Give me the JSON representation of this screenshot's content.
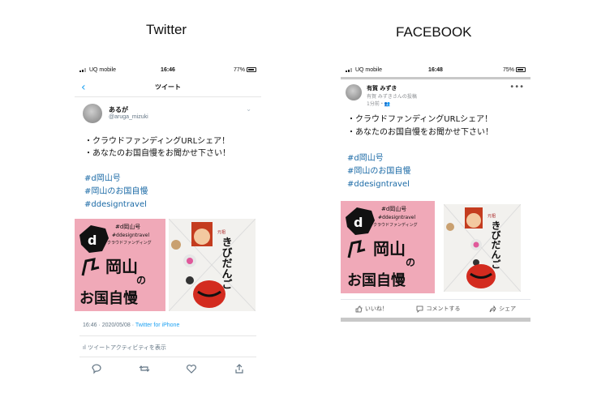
{
  "columns": {
    "twitter_title": "Twitter",
    "facebook_title": "FACEBOOK"
  },
  "twitter": {
    "status": {
      "carrier": "UQ mobile",
      "time": "16:46",
      "battery": "77%"
    },
    "nav_title": "ツイート",
    "user": {
      "name": "あるが",
      "handle": "@aruga_mizuki"
    },
    "body_lines": [
      "・クラウドファンディングURLシェア！",
      "・あなたのお国自慢をお聞かせ下さい！"
    ],
    "hashtags": [
      "#d岡山号",
      "#岡山のお国自慢",
      "#ddesigntravel"
    ],
    "timestamp": "16:46 · 2020/05/08 · ",
    "source": "Twitter for iPhone",
    "activity_label": "ツイートアクティビティを表示",
    "icons": [
      "reply-icon",
      "retweet-icon",
      "like-icon",
      "share-icon"
    ]
  },
  "facebook": {
    "status": {
      "carrier": "UQ mobile",
      "time": "16:48",
      "battery": "75%"
    },
    "user": {
      "name": "有賀 みずき"
    },
    "subline": "有賀 みずきさんの投稿",
    "time_ago": "1分前・",
    "more_label": "•••",
    "body_lines": [
      "・クラウドファンディングURLシェア！",
      "・あなたのお国自慢をお聞かせ下さい！"
    ],
    "hashtags": [
      "#d岡山号",
      "#岡山のお国自慢",
      "#ddesigntravel"
    ],
    "actions": {
      "like": "いいね！",
      "comment": "コメントする",
      "share": "シェア"
    }
  },
  "poster": {
    "logo": "d",
    "tags": [
      "#d岡山号",
      "#ddesigntravel",
      "クラウドファンディング"
    ],
    "main_text": [
      "岡山",
      "の",
      "お国自慢"
    ],
    "bg_color": "#f0a9b8"
  },
  "package": {
    "label": "きびだんご",
    "small_label": "元祖",
    "bg_color": "#f2f1ee"
  }
}
